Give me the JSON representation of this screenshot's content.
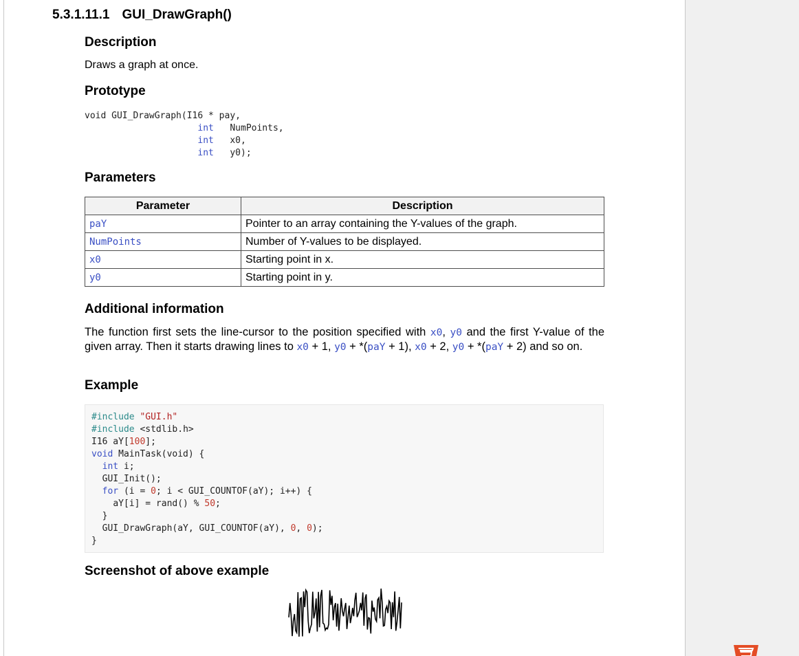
{
  "heading": {
    "number": "5.3.1.11.1",
    "title": "GUI_DrawGraph()"
  },
  "description": {
    "title": "Description",
    "text": "Draws a graph at once."
  },
  "prototype": {
    "title": "Prototype",
    "line1_code": "void GUI_DrawGraph(I16 * pay,",
    "line2_type": "int",
    "line2_name": "NumPoints,",
    "line3_type": "int",
    "line3_name": "x0,",
    "line4_type": "int",
    "line4_name": "y0);"
  },
  "parameters": {
    "title": "Parameters",
    "header_param": "Parameter",
    "header_desc": "Description",
    "rows": [
      {
        "name": "paY",
        "desc": "Pointer to an array containing the Y-values of the graph."
      },
      {
        "name": "NumPoints",
        "desc": "Number of Y-values to be displayed."
      },
      {
        "name": "x0",
        "desc": "Starting point in x."
      },
      {
        "name": "y0",
        "desc": "Starting point in y."
      }
    ]
  },
  "additional": {
    "title": "Additional information",
    "t1": "The function first sets the line-cursor to the position specified with ",
    "c1": "x0",
    "t2": ", ",
    "c2": "y0",
    "t3": " and the first Y-value of the given array. Then it starts drawing lines to ",
    "c3": "x0",
    "t4": " + 1, ",
    "c4": "y0",
    "t5": " + *(",
    "c5": "paY",
    "t6": " + 1), ",
    "c6": "x0",
    "t7": " + 2, ",
    "c7": "y0",
    "t8": " + *(",
    "c8": "paY",
    "t9": " + 2) and so on."
  },
  "example": {
    "title": "Example",
    "l1_pp": "#include",
    "l1_str": "\"GUI.h\"",
    "l2_pp": "#include",
    "l2_rest": "<stdlib.h>",
    "l3_a": "I16 aY[",
    "l3_num": "100",
    "l3_b": "];",
    "l4_kw": "void",
    "l4_rest": "MainTask(void) {",
    "l5_kw": "int",
    "l5_rest": "i;",
    "l6": "GUI_Init();",
    "l7_kw": "for",
    "l7_a": "(i = ",
    "l7_n0": "0",
    "l7_b": "; i < GUI_COUNTOF(aY); i++) {",
    "l8_a": "aY[i] = rand() % ",
    "l8_num": "50",
    "l8_b": ";",
    "l9": "}",
    "l10_a": "GUI_DrawGraph(aY, GUI_COUNTOF(aY), ",
    "l10_n1": "0",
    "l10_sep": ", ",
    "l10_n2": "0",
    "l10_b": ");",
    "l11": "}"
  },
  "screenshot": {
    "title": "Screenshot of above example"
  },
  "colors": {
    "code_blue": "#3a4fc4",
    "table_border": "#4d4d4d",
    "html5_orange": "#e44d26"
  },
  "icons": {
    "html5": "html5-logo-icon"
  }
}
